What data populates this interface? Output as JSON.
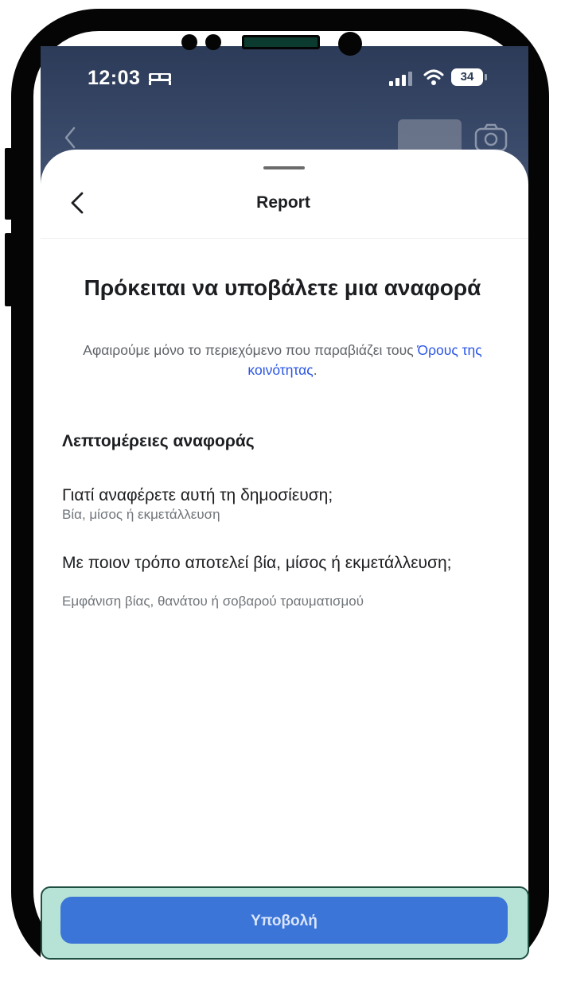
{
  "status_bar": {
    "time": "12:03",
    "battery": "34"
  },
  "header": {
    "title": "Report"
  },
  "intro": {
    "headline": "Πρόκειται να υποβάλετε μια αναφορά",
    "subtext_prefix": "Αφαιρούμε μόνο το περιεχόμενο που παραβιάζει τους ",
    "subtext_link": "Όρους της κοινότητας",
    "subtext_suffix": "."
  },
  "details": {
    "section_title": "Λεπτομέρειες αναφοράς",
    "items": [
      {
        "question": "Γιατί αναφέρετε αυτή τη δημοσίευση;",
        "answer": "Βία, μίσος ή εκμετάλλευση"
      },
      {
        "question": "Με ποιον τρόπο αποτελεί βία, μίσος ή εκμετάλλευση;",
        "answer": "Εμφάνιση βίας, θανάτου ή σοβαρού τραυματισμού"
      }
    ]
  },
  "footer": {
    "submit_label": "Υποβολή"
  },
  "icons": [
    "bed-icon",
    "signal-icon",
    "wifi-icon",
    "battery-icon",
    "chevron-left-icon",
    "camera-icon"
  ],
  "colors": {
    "accent": "#3c75d8",
    "link": "#2a55e5",
    "highlight": "#b7e3d6"
  }
}
